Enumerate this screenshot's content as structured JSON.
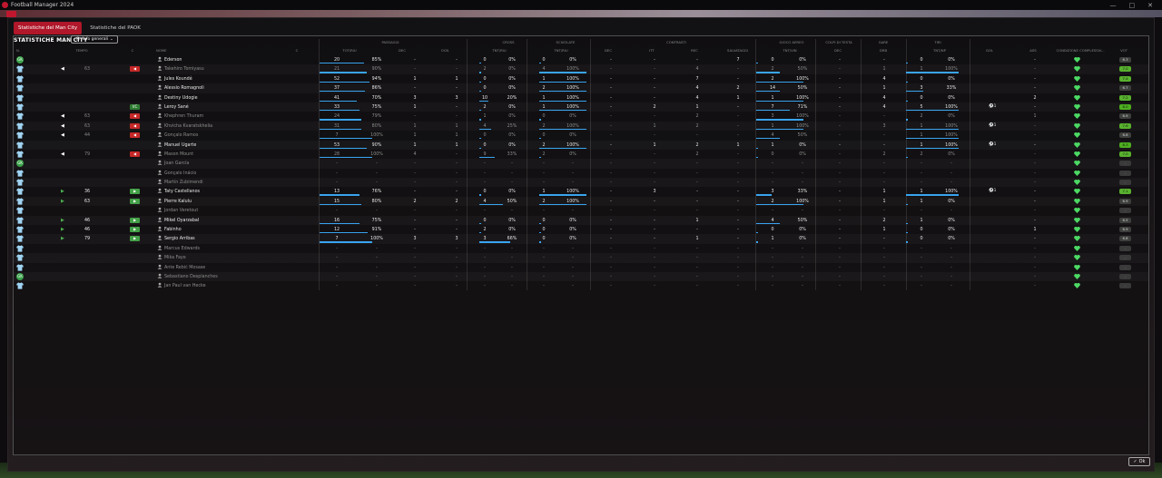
{
  "window": {
    "title": "Football Manager 2024",
    "controls": [
      "—",
      "□",
      "✕"
    ]
  },
  "tabs": [
    {
      "label": "Statistiche del Man City",
      "active": true
    },
    {
      "label": "Statistiche del PAOK",
      "active": false
    }
  ],
  "panel": {
    "title": "STATISTICHE MAN CITY",
    "view_label": "Info generali"
  },
  "group_headers": {
    "passaggi": "PASSAGGI",
    "cross": "CROSS",
    "scivolate": "SCIVOLATE",
    "contrasti": "CONTRASTI",
    "gioco_aereo": "GIOCO AEREO",
    "colpi_di_testa": "COLPI DI TESTA",
    "gare": "GARE",
    "tiri": "TIRI"
  },
  "col_headers": {
    "pos": "N.",
    "tempo": "TEMPO",
    "c": "C",
    "nome": "NOME",
    "c2": "C",
    "pass_tot": "TOT/RIU",
    "pass_dec": "DEC",
    "pass_occ": "OCN",
    "cross": "TNT/RIU",
    "sciv": "TNT/RIU",
    "contr_dec": "DEC",
    "contr_itt": "ITT",
    "contr_rec": "REC",
    "contr_salv": "SALVATAGGI",
    "aereo": "TNT/VIN",
    "testa": "DEC",
    "drib": "DRB",
    "tiri": "TNT/NP",
    "gol": "GOL",
    "ass": "ASS",
    "condizione": "CONDIZIONE COMPLESSIV...",
    "vot": "VOT"
  },
  "players": [
    {
      "name": "Ederson",
      "tempo": "",
      "badge": "",
      "pass": "20",
      "passp": "85%",
      "dec": "-",
      "occ": "-",
      "cross": "0",
      "crossp": "0%",
      "sciv": "0",
      "scivp": "0%",
      "cdec": "-",
      "itt": "-",
      "rec": "-",
      "salv": "7",
      "aer": "0",
      "aerp": "0%",
      "testa": "-",
      "drib": "-",
      "tiri": "0",
      "tirip": "0%",
      "gol": "",
      "ass": "-",
      "rating": "6.3",
      "gk": true,
      "dim": false
    },
    {
      "name": "Takehiro Tomiyasu",
      "tempo": "63",
      "badge": "out",
      "pass": "21",
      "passp": "90%",
      "dec": "-",
      "occ": "-",
      "cross": "2",
      "crossp": "0%",
      "sciv": "4",
      "scivp": "100%",
      "cdec": "-",
      "itt": "-",
      "rec": "4",
      "salv": "-",
      "aer": "2",
      "aerp": "50%",
      "testa": "-",
      "drib": "1",
      "tiri": "1",
      "tirip": "100%",
      "gol": "",
      "ass": "-",
      "rating": "7.0",
      "gk": false,
      "dim": true
    },
    {
      "name": "Jules Koundé",
      "tempo": "",
      "badge": "",
      "pass": "52",
      "passp": "94%",
      "dec": "1",
      "occ": "1",
      "cross": "0",
      "crossp": "0%",
      "sciv": "1",
      "scivp": "100%",
      "cdec": "-",
      "itt": "-",
      "rec": "7",
      "salv": "-",
      "aer": "2",
      "aerp": "100%",
      "testa": "-",
      "drib": "4",
      "tiri": "0",
      "tirip": "0%",
      "gol": "",
      "ass": "-",
      "rating": "7.4",
      "gk": false,
      "dim": false
    },
    {
      "name": "Alessio Romagnoli",
      "tempo": "",
      "badge": "",
      "pass": "37",
      "passp": "86%",
      "dec": "-",
      "occ": "-",
      "cross": "0",
      "crossp": "0%",
      "sciv": "2",
      "scivp": "100%",
      "cdec": "-",
      "itt": "-",
      "rec": "4",
      "salv": "2",
      "aer": "14",
      "aerp": "50%",
      "testa": "-",
      "drib": "1",
      "tiri": "3",
      "tirip": "33%",
      "gol": "",
      "ass": "-",
      "rating": "6.7",
      "gk": false,
      "dim": false
    },
    {
      "name": "Destiny Udogie",
      "tempo": "",
      "badge": "",
      "pass": "41",
      "passp": "70%",
      "dec": "3",
      "occ": "3",
      "cross": "10",
      "crossp": "20%",
      "sciv": "1",
      "scivp": "100%",
      "cdec": "-",
      "itt": "-",
      "rec": "4",
      "salv": "1",
      "aer": "1",
      "aerp": "100%",
      "testa": "-",
      "drib": "4",
      "tiri": "0",
      "tirip": "0%",
      "gol": "",
      "ass": "2",
      "rating": "7.2",
      "gk": false,
      "dim": false
    },
    {
      "name": "Leroy Sané",
      "tempo": "",
      "badge": "vc",
      "pass": "33",
      "passp": "75%",
      "dec": "1",
      "occ": "-",
      "cross": "2",
      "crossp": "0%",
      "sciv": "1",
      "scivp": "100%",
      "cdec": "-",
      "itt": "2",
      "rec": "1",
      "salv": "-",
      "aer": "7",
      "aerp": "71%",
      "testa": "-",
      "drib": "4",
      "tiri": "5",
      "tirip": "100%",
      "gol": "1",
      "ass": "-",
      "rating": "8.0",
      "gk": false,
      "dim": false
    },
    {
      "name": "Khephren Thuram",
      "tempo": "63",
      "badge": "out",
      "pass": "24",
      "passp": "79%",
      "dec": "-",
      "occ": "-",
      "cross": "1",
      "crossp": "0%",
      "sciv": "0",
      "scivp": "0%",
      "cdec": "-",
      "itt": "-",
      "rec": "2",
      "salv": "-",
      "aer": "3",
      "aerp": "100%",
      "testa": "-",
      "drib": "-",
      "tiri": "2",
      "tirip": "0%",
      "gol": "",
      "ass": "1",
      "rating": "6.9",
      "gk": false,
      "dim": true
    },
    {
      "name": "Khvicha Kvaratskhelia",
      "tempo": "63",
      "badge": "out",
      "pass": "31",
      "passp": "80%",
      "dec": "1",
      "occ": "1",
      "cross": "4",
      "crossp": "25%",
      "sciv": "2",
      "scivp": "100%",
      "cdec": "-",
      "itt": "1",
      "rec": "2",
      "salv": "-",
      "aer": "1",
      "aerp": "100%",
      "testa": "-",
      "drib": "3",
      "tiri": "1",
      "tirip": "100%",
      "gol": "1",
      "ass": "-",
      "rating": "7.6",
      "gk": false,
      "dim": true
    },
    {
      "name": "Gonçalo Ramos",
      "tempo": "44",
      "badge": "out",
      "pass": "7",
      "passp": "100%",
      "dec": "1",
      "occ": "1",
      "cross": "0",
      "crossp": "0%",
      "sciv": "0",
      "scivp": "0%",
      "cdec": "-",
      "itt": "-",
      "rec": "-",
      "salv": "-",
      "aer": "4",
      "aerp": "50%",
      "testa": "-",
      "drib": "-",
      "tiri": "1",
      "tirip": "100%",
      "gol": "",
      "ass": "-",
      "rating": "6.6",
      "gk": false,
      "dim": true
    },
    {
      "name": "Manuel Ugarte",
      "tempo": "",
      "badge": "",
      "pass": "53",
      "passp": "90%",
      "dec": "1",
      "occ": "1",
      "cross": "0",
      "crossp": "0%",
      "sciv": "2",
      "scivp": "100%",
      "cdec": "-",
      "itt": "1",
      "rec": "2",
      "salv": "1",
      "aer": "1",
      "aerp": "0%",
      "testa": "-",
      "drib": "-",
      "tiri": "1",
      "tirip": "100%",
      "gol": "1",
      "ass": "-",
      "rating": "8.3",
      "gk": false,
      "dim": false
    },
    {
      "name": "Mason Mount",
      "tempo": "79",
      "badge": "out",
      "pass": "28",
      "passp": "100%",
      "dec": "4",
      "occ": "-",
      "cross": "9",
      "crossp": "33%",
      "sciv": "2",
      "scivp": "0%",
      "cdec": "-",
      "itt": "-",
      "rec": "2",
      "salv": "-",
      "aer": "0",
      "aerp": "0%",
      "testa": "-",
      "drib": "2",
      "tiri": "2",
      "tirip": "0%",
      "gol": "",
      "ass": "-",
      "rating": "7.0",
      "gk": false,
      "dim": true
    },
    {
      "name": "Joan García",
      "tempo": "",
      "badge": "",
      "pass": "-",
      "passp": "-",
      "dec": "-",
      "occ": "-",
      "cross": "-",
      "crossp": "-",
      "sciv": "-",
      "scivp": "-",
      "cdec": "-",
      "itt": "-",
      "rec": "-",
      "salv": "-",
      "aer": "-",
      "aerp": "-",
      "testa": "-",
      "drib": "-",
      "tiri": "-",
      "tirip": "-",
      "gol": "",
      "ass": "-",
      "rating": "-",
      "gk": true,
      "dim": true
    },
    {
      "name": "Gonçalo Inácio",
      "tempo": "",
      "badge": "",
      "pass": "-",
      "passp": "-",
      "dec": "-",
      "occ": "-",
      "cross": "-",
      "crossp": "-",
      "sciv": "-",
      "scivp": "-",
      "cdec": "-",
      "itt": "-",
      "rec": "-",
      "salv": "-",
      "aer": "-",
      "aerp": "-",
      "testa": "-",
      "drib": "-",
      "tiri": "-",
      "tirip": "-",
      "gol": "",
      "ass": "-",
      "rating": "-",
      "gk": false,
      "dim": true
    },
    {
      "name": "Martín Zubimendi",
      "tempo": "",
      "badge": "",
      "pass": "-",
      "passp": "-",
      "dec": "-",
      "occ": "-",
      "cross": "-",
      "crossp": "-",
      "sciv": "-",
      "scivp": "-",
      "cdec": "-",
      "itt": "-",
      "rec": "-",
      "salv": "-",
      "aer": "-",
      "aerp": "-",
      "testa": "-",
      "drib": "-",
      "tiri": "-",
      "tirip": "-",
      "gol": "",
      "ass": "-",
      "rating": "-",
      "gk": false,
      "dim": true
    },
    {
      "name": "Taty Castellanos",
      "tempo": "36",
      "badge": "in",
      "pass": "13",
      "passp": "76%",
      "dec": "-",
      "occ": "-",
      "cross": "0",
      "crossp": "0%",
      "sciv": "1",
      "scivp": "100%",
      "cdec": "-",
      "itt": "3",
      "rec": "-",
      "salv": "-",
      "aer": "3",
      "aerp": "33%",
      "testa": "-",
      "drib": "1",
      "tiri": "1",
      "tirip": "100%",
      "gol": "1",
      "ass": "-",
      "rating": "7.1",
      "gk": false,
      "dim": false
    },
    {
      "name": "Pierre Kalulu",
      "tempo": "63",
      "badge": "in",
      "pass": "15",
      "passp": "80%",
      "dec": "2",
      "occ": "2",
      "cross": "4",
      "crossp": "50%",
      "sciv": "2",
      "scivp": "100%",
      "cdec": "-",
      "itt": "-",
      "rec": "-",
      "salv": "-",
      "aer": "2",
      "aerp": "100%",
      "testa": "-",
      "drib": "1",
      "tiri": "1",
      "tirip": "0%",
      "gol": "",
      "ass": "-",
      "rating": "6.9",
      "gk": false,
      "dim": false
    },
    {
      "name": "Jordan Veretout",
      "tempo": "",
      "badge": "",
      "pass": "-",
      "passp": "-",
      "dec": "-",
      "occ": "-",
      "cross": "-",
      "crossp": "-",
      "sciv": "-",
      "scivp": "-",
      "cdec": "-",
      "itt": "-",
      "rec": "-",
      "salv": "-",
      "aer": "-",
      "aerp": "-",
      "testa": "-",
      "drib": "-",
      "tiri": "-",
      "tirip": "-",
      "gol": "",
      "ass": "-",
      "rating": "-",
      "gk": false,
      "dim": true
    },
    {
      "name": "Mikel Oyarzabal",
      "tempo": "46",
      "badge": "in",
      "pass": "16",
      "passp": "75%",
      "dec": "-",
      "occ": "-",
      "cross": "0",
      "crossp": "0%",
      "sciv": "0",
      "scivp": "0%",
      "cdec": "-",
      "itt": "-",
      "rec": "1",
      "salv": "-",
      "aer": "4",
      "aerp": "50%",
      "testa": "-",
      "drib": "2",
      "tiri": "1",
      "tirip": "0%",
      "gol": "",
      "ass": "-",
      "rating": "6.5",
      "gk": false,
      "dim": false
    },
    {
      "name": "Fabinho",
      "tempo": "46",
      "badge": "in",
      "pass": "12",
      "passp": "91%",
      "dec": "-",
      "occ": "-",
      "cross": "2",
      "crossp": "0%",
      "sciv": "0",
      "scivp": "0%",
      "cdec": "-",
      "itt": "-",
      "rec": "-",
      "salv": "-",
      "aer": "0",
      "aerp": "0%",
      "testa": "-",
      "drib": "1",
      "tiri": "0",
      "tirip": "0%",
      "gol": "",
      "ass": "1",
      "rating": "6.9",
      "gk": false,
      "dim": false
    },
    {
      "name": "Sergio Arribas",
      "tempo": "79",
      "badge": "in",
      "pass": "7",
      "passp": "100%",
      "dec": "3",
      "occ": "3",
      "cross": "3",
      "crossp": "66%",
      "sciv": "0",
      "scivp": "0%",
      "cdec": "-",
      "itt": "-",
      "rec": "1",
      "salv": "-",
      "aer": "1",
      "aerp": "0%",
      "testa": "-",
      "drib": "-",
      "tiri": "0",
      "tirip": "0%",
      "gol": "",
      "ass": "-",
      "rating": "6.8",
      "gk": false,
      "dim": false
    },
    {
      "name": "Marcus Edwards",
      "tempo": "",
      "badge": "",
      "pass": "-",
      "passp": "-",
      "dec": "-",
      "occ": "-",
      "cross": "-",
      "crossp": "-",
      "sciv": "-",
      "scivp": "-",
      "cdec": "-",
      "itt": "-",
      "rec": "-",
      "salv": "-",
      "aer": "-",
      "aerp": "-",
      "testa": "-",
      "drib": "-",
      "tiri": "-",
      "tirip": "-",
      "gol": "",
      "ass": "-",
      "rating": "-",
      "gk": false,
      "dim": true
    },
    {
      "name": "Mika Faye",
      "tempo": "",
      "badge": "",
      "pass": "-",
      "passp": "-",
      "dec": "-",
      "occ": "-",
      "cross": "-",
      "crossp": "-",
      "sciv": "-",
      "scivp": "-",
      "cdec": "-",
      "itt": "-",
      "rec": "-",
      "salv": "-",
      "aer": "-",
      "aerp": "-",
      "testa": "-",
      "drib": "-",
      "tiri": "-",
      "tirip": "-",
      "gol": "",
      "ass": "-",
      "rating": "-",
      "gk": false,
      "dim": true
    },
    {
      "name": "Ante Rebić Mosase",
      "tempo": "",
      "badge": "",
      "pass": "-",
      "passp": "-",
      "dec": "-",
      "occ": "-",
      "cross": "-",
      "crossp": "-",
      "sciv": "-",
      "scivp": "-",
      "cdec": "-",
      "itt": "-",
      "rec": "-",
      "salv": "-",
      "aer": "-",
      "aerp": "-",
      "testa": "-",
      "drib": "-",
      "tiri": "-",
      "tirip": "-",
      "gol": "",
      "ass": "-",
      "rating": "-",
      "gk": false,
      "dim": true
    },
    {
      "name": "Sebastiano Desplanches",
      "tempo": "",
      "badge": "",
      "pass": "-",
      "passp": "-",
      "dec": "-",
      "occ": "-",
      "cross": "-",
      "crossp": "-",
      "sciv": "-",
      "scivp": "-",
      "cdec": "-",
      "itt": "-",
      "rec": "-",
      "salv": "-",
      "aer": "-",
      "aerp": "-",
      "testa": "-",
      "drib": "-",
      "tiri": "-",
      "tirip": "-",
      "gol": "",
      "ass": "-",
      "rating": "-",
      "gk": true,
      "dim": true
    },
    {
      "name": "Jan Paul van Hecke",
      "tempo": "",
      "badge": "",
      "pass": "-",
      "passp": "-",
      "dec": "-",
      "occ": "-",
      "cross": "-",
      "crossp": "-",
      "sciv": "-",
      "scivp": "-",
      "cdec": "-",
      "itt": "-",
      "rec": "-",
      "salv": "-",
      "aer": "-",
      "aerp": "-",
      "testa": "-",
      "drib": "-",
      "tiri": "-",
      "tirip": "-",
      "gol": "",
      "ass": "-",
      "rating": "-",
      "gk": false,
      "dim": true
    }
  ],
  "ok_label": "Ok",
  "colors": {
    "accent": "#b0172a",
    "bar": "#39a4f0",
    "rating": "#7cc43a",
    "heart": "#4cd964"
  }
}
